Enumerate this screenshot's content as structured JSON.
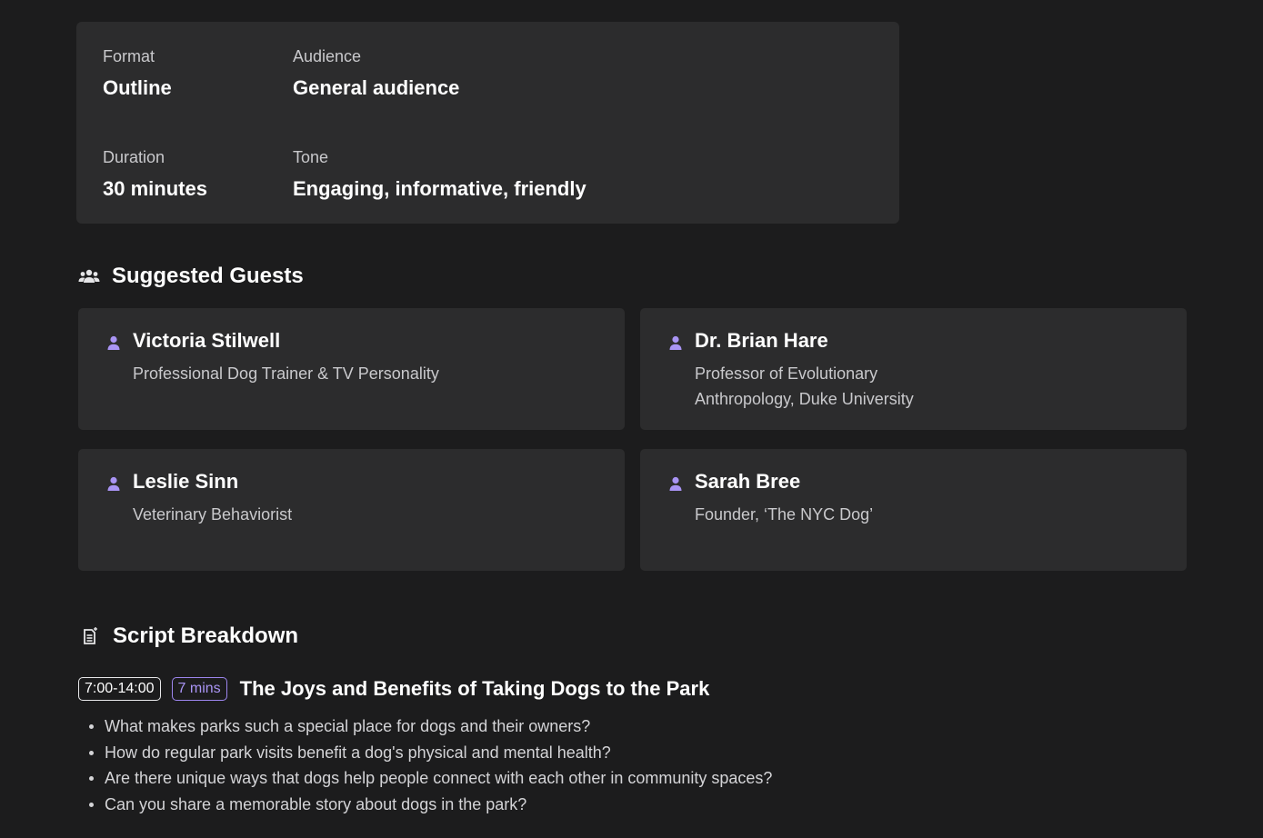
{
  "summary": {
    "format": {
      "label": "Format",
      "value": "Outline"
    },
    "audience": {
      "label": "Audience",
      "value": "General audience"
    },
    "duration": {
      "label": "Duration",
      "value": "30 minutes"
    },
    "tone": {
      "label": "Tone",
      "value": "Engaging, informative, friendly"
    }
  },
  "guests_section": {
    "title": "Suggested Guests",
    "icon": "people-group-icon",
    "guests": [
      {
        "name": "Victoria Stilwell",
        "role": "Professional Dog Trainer & TV Personality"
      },
      {
        "name": "Dr. Brian Hare",
        "role": "Professor of Evolutionary Anthropology, Duke University"
      },
      {
        "name": "Leslie Sinn",
        "role": "Veterinary Behaviorist"
      },
      {
        "name": "Sarah Bree",
        "role": "Founder, ‘The NYC Dog’"
      }
    ]
  },
  "script_section": {
    "title": "Script Breakdown",
    "icon": "document-icon",
    "segment": {
      "time_range": "7:00-14:00",
      "duration": "7 mins",
      "title": "The Joys and Benefits of Taking Dogs to the Park",
      "questions": [
        "What makes parks such a special place for dogs and their owners?",
        "How do regular park visits benefit a dog's physical and mental health?",
        "Are there unique ways that dogs help people connect with each other in community spaces?",
        "Can you share a memorable story about dogs in the park?"
      ]
    }
  },
  "colors": {
    "background": "#1c1c1d",
    "card": "#2c2c2d",
    "accent": "#a994f4"
  }
}
